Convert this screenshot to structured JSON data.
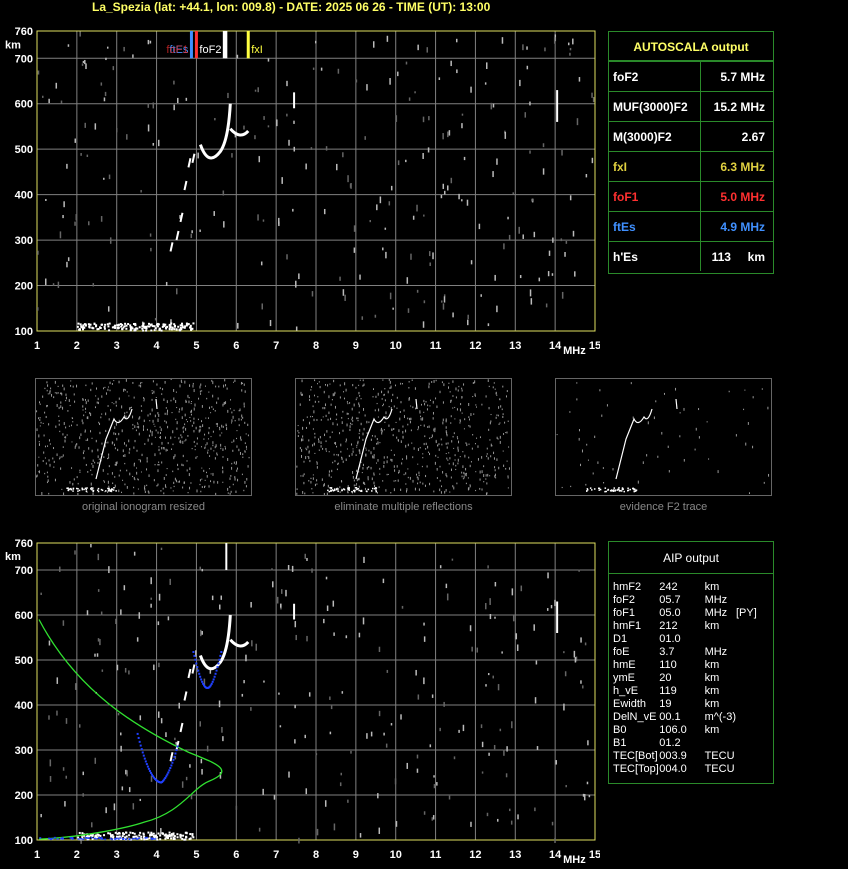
{
  "header": {
    "title": "La_Spezia (lat: +44.1, lon: 009.8) - DATE: 2025 06 26 - TIME (UT): 13:00"
  },
  "axes": {
    "km_label": "km",
    "mhz_label": "MHz",
    "y_ticks": [
      "760",
      "700",
      "600",
      "500",
      "400",
      "300",
      "200",
      "100"
    ],
    "x_ticks": [
      "1",
      "2",
      "3",
      "4",
      "5",
      "6",
      "7",
      "8",
      "9",
      "10",
      "11",
      "12",
      "13",
      "14",
      "15"
    ]
  },
  "top_plot": {
    "markers": {
      "ftes": "ftEs",
      "fof1": "foF1",
      "fof2": "foF2",
      "fxi": "fxI"
    }
  },
  "autoscala": {
    "title": "AUTOSCALA output",
    "rows": [
      {
        "label": "foF2",
        "value": "5.7 MHz",
        "color": "#ffffff"
      },
      {
        "label": "MUF(3000)F2",
        "value": "15.2 MHz",
        "color": "#ffffff"
      },
      {
        "label": "M(3000)F2",
        "value": "2.67",
        "color": "#ffffff"
      },
      {
        "label": "fxI",
        "value": "6.3 MHz",
        "color": "#e0d040"
      },
      {
        "label": "foF1",
        "value": "5.0 MHz",
        "color": "#ff3030"
      },
      {
        "label": "ftEs",
        "value": "4.9 MHz",
        "color": "#4090ff"
      },
      {
        "label": "h'Es",
        "value": "113     km",
        "color": "#ffffff"
      }
    ]
  },
  "thumbnails": {
    "captions": [
      "original ionogram resized",
      "eliminate multiple reflections",
      "evidence F2 trace"
    ]
  },
  "aip": {
    "title": "AIP output",
    "rows": [
      {
        "k": "hmF2",
        "n": "242",
        "u": "km",
        "x": ""
      },
      {
        "k": "foF2",
        "n": "05.7",
        "u": "MHz",
        "x": ""
      },
      {
        "k": "foF1",
        "n": "05.0",
        "u": "MHz",
        "x": "[PY]"
      },
      {
        "k": "hmF1",
        "n": "212",
        "u": "km",
        "x": ""
      },
      {
        "k": "D1",
        "n": "01.0",
        "u": "",
        "x": ""
      },
      {
        "k": "foE",
        "n": "3.7",
        "u": "MHz",
        "x": ""
      },
      {
        "k": "hmE",
        "n": "110",
        "u": "km",
        "x": ""
      },
      {
        "k": "ymE",
        "n": "20",
        "u": "km",
        "x": ""
      },
      {
        "k": "h_vE",
        "n": "119",
        "u": "km",
        "x": ""
      },
      {
        "k": "Ewidth",
        "n": "19",
        "u": "km",
        "x": ""
      },
      {
        "k": "DelN_vE",
        "n": "00.1",
        "u": "m^(-3)",
        "x": ""
      },
      {
        "k": "B0",
        "n": "106.0",
        "u": "km",
        "x": ""
      },
      {
        "k": "B1",
        "n": "01.2",
        "u": "",
        "x": ""
      },
      {
        "k": "TEC[Bot]",
        "n": "003.9",
        "u": "TECU",
        "x": ""
      },
      {
        "k": "TEC[Top]",
        "n": "004.0",
        "u": "TECU",
        "x": ""
      }
    ]
  },
  "colors": {
    "grid": "#808080",
    "frame": "#e0e060",
    "panel_border": "#2a8a2a",
    "profile": "#30e030",
    "trace_blue": "#2040ff"
  }
}
